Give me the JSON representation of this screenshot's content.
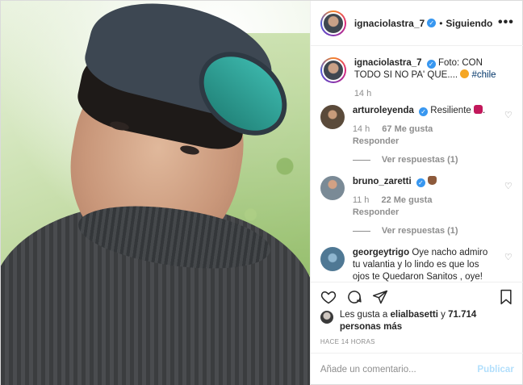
{
  "post": {
    "author": "ignaciolastra_7",
    "separator": "•",
    "follow_status": "Siguiendo",
    "more_label": "•••"
  },
  "caption": {
    "author": "ignaciolastra_7",
    "text": "Foto: CON TODO SI NO PA' QUE....",
    "hashtag": "#chile",
    "time": "14 h"
  },
  "comments": [
    {
      "user": "arturoleyenda",
      "text": "Resiliente",
      "time": "14 h",
      "likes": "67 Me gusta",
      "reply_label": "Responder",
      "view_replies": "Ver respuestas (1)"
    },
    {
      "user": "bruno_zaretti",
      "text": "",
      "time": "11 h",
      "likes": "22 Me gusta",
      "reply_label": "Responder",
      "view_replies": "Ver respuestas (1)"
    },
    {
      "user": "georgeytrigo",
      "text": "Oye nacho admiro tu valantia y lo lindo es que los ojos te Quedaron Sanitos , oye! Sacame de una Duda\" con el"
    }
  ],
  "likes_line": {
    "prefix": "Les gusta a",
    "user": "elialbasetti",
    "joiner": "y",
    "others": "71.714 personas más"
  },
  "timestamp": "HACE 14 HORAS",
  "composer": {
    "placeholder": "Añade un comentario...",
    "publish_label": "Publicar"
  },
  "icons": {
    "verified": "verified-badge-icon",
    "heart": "heart-icon",
    "comment": "comment-icon",
    "share": "share-icon",
    "save": "bookmark-icon"
  },
  "colors": {
    "verified": "#3897f0",
    "link": "#003569",
    "muted": "#8e8e8e",
    "publish_disabled": "#b2dffc"
  }
}
